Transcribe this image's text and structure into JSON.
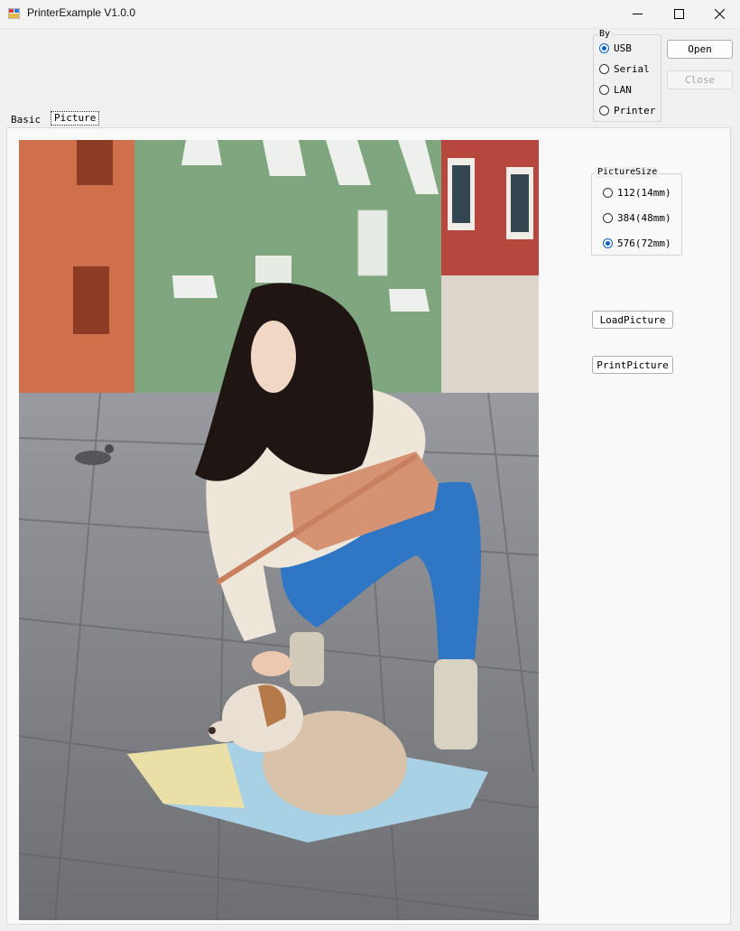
{
  "window": {
    "title": "PrinterExample V1.0.0",
    "controls": {
      "minimize": "minimize-icon",
      "maximize": "maximize-icon",
      "close": "close-icon"
    }
  },
  "connection": {
    "group_label": "By",
    "options": [
      {
        "label": "USB",
        "checked": true
      },
      {
        "label": "Serial",
        "checked": false
      },
      {
        "label": "LAN",
        "checked": false
      },
      {
        "label": "Printer",
        "checked": false
      }
    ],
    "open_label": "Open",
    "close_label": "Close"
  },
  "tabs": [
    {
      "label": "Basic",
      "selected": false
    },
    {
      "label": "Picture",
      "selected": true
    }
  ],
  "picture_tab": {
    "size_group_label": "PictureSize",
    "sizes": [
      {
        "label": "112(14mm)",
        "checked": false
      },
      {
        "label": "384(48mm)",
        "checked": false
      },
      {
        "label": "576(72mm)",
        "checked": true
      }
    ],
    "load_label": "LoadPicture",
    "print_label": "PrintPicture"
  },
  "colors": {
    "accent": "#0a5fc6",
    "window_bg": "#f0f0f0",
    "panel_bg": "#f9f9f9"
  }
}
